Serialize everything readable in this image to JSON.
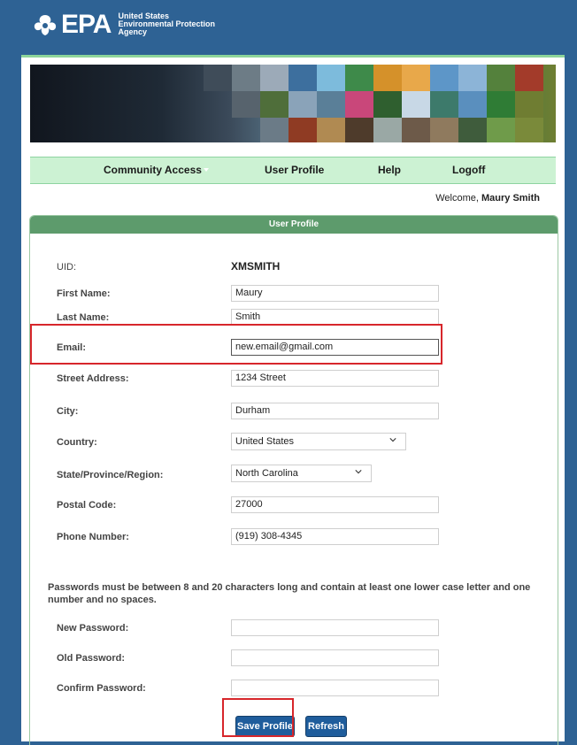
{
  "header": {
    "logo_text": "EPA",
    "agency_lines": [
      "United States",
      "Environmental Protection",
      "Agency"
    ]
  },
  "nav": {
    "items": [
      "Community Access",
      "User Profile",
      "Help",
      "Logoff"
    ]
  },
  "welcome": {
    "prefix": "Welcome,",
    "user": "Maury Smith"
  },
  "panel": {
    "title": "User Profile"
  },
  "form": {
    "uid_label": "UID:",
    "uid_value": "XMSMITH",
    "first_name_label": "First Name:",
    "first_name_value": "Maury",
    "last_name_label": "Last Name:",
    "last_name_value": "Smith",
    "email_label": "Email:",
    "email_value": "new.email@gmail.com",
    "street_label": "Street Address:",
    "street_value": "1234 Street",
    "city_label": "City:",
    "city_value": "Durham",
    "country_label": "Country:",
    "country_value": "United States",
    "state_label": "State/Province/Region:",
    "state_value": "North Carolina",
    "postal_label": "Postal Code:",
    "postal_value": "27000",
    "phone_label": "Phone Number:",
    "phone_value": "(919) 308-4345",
    "password_note": "Passwords must be between 8 and 20 characters long and contain at least one lower case letter and one number and no spaces.",
    "new_password_label": "New Password:",
    "old_password_label": "Old Password:",
    "confirm_password_label": "Confirm Password:",
    "new_password_value": "",
    "old_password_value": "",
    "confirm_password_value": ""
  },
  "buttons": {
    "save": "Save Profile",
    "refresh": "Refresh"
  },
  "colors": {
    "page_bg": "#2e6294",
    "nav_bg": "#ccf2d3",
    "panel_header": "#5d9b6c",
    "button": "#1f5d9c",
    "highlight": "#d7262b"
  }
}
